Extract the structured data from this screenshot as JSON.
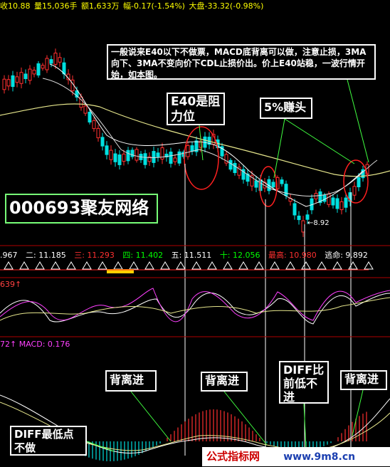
{
  "topbar": {
    "items": [
      {
        "text": "收10.88",
        "color": "#ffff00"
      },
      {
        "text": "量15,036手",
        "color": "#ffff00"
      },
      {
        "text": "额1,633万",
        "color": "#ffff00"
      },
      {
        "text": "幅-0.17(-1.54%)",
        "color": "#ffff00"
      },
      {
        "text": "大盘-33.32(-0.98%)",
        "color": "#ffff00"
      }
    ]
  },
  "notes": {
    "main": "一般说来E40以下不做票，MACD底背离可以做，注意止损，3MA向下、3MA不变向价下CDL止损价出。价上E40站稳，一波行情开始，如本图。",
    "e40": "E40是阻力位",
    "earn": "5%赚头",
    "stock": "000693聚友网络",
    "b1": "背离进",
    "b2": "背离进",
    "b3": "DIFF比前低不进",
    "b4": "背离进",
    "d1": "DIFF最低点不做"
  },
  "low_label": "←8.92",
  "ma_row": [
    {
      "text": ".967",
      "color": "#ffffff"
    },
    {
      "text": "二: 11.185",
      "color": "#ffffff"
    },
    {
      "text": "三: 11.293",
      "color": "#ff3030"
    },
    {
      "text": "四: 11.402",
      "color": "#00ff00"
    },
    {
      "text": "五: 11.511",
      "color": "#ffffff"
    },
    {
      "text": "十: 12.056",
      "color": "#00ff00"
    },
    {
      "text": "最高: 10.980",
      "color": "#ff3030"
    },
    {
      "text": "逃命: 9.892",
      "color": "#ffffff"
    }
  ],
  "ind_row": {
    "text": "639",
    "color": "#ff4040"
  },
  "macd_row": {
    "prefix": "72",
    "label": "MACD: 0.176",
    "color": "#ff40ff"
  },
  "watermark": {
    "left": "公式指标网",
    "right": "www.9m8.cn"
  },
  "colors": {
    "up": "#ff3030",
    "down": "#00e0e0",
    "ma_yellow": "#e6e68c",
    "ma_white": "#ffffff",
    "red_ellipse": "#ff2020",
    "green_line": "#40ff40"
  }
}
